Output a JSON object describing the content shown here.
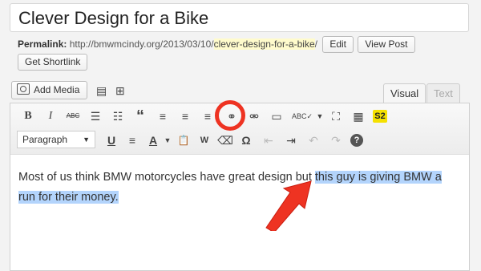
{
  "post": {
    "title": "Clever Design for a Bike"
  },
  "permalink": {
    "label": "Permalink:",
    "base": "http://bmwmcindy.org/2013/03/10/",
    "slug": "clever-design-for-a-bike",
    "trailing": "/",
    "edit_label": "Edit",
    "view_post_label": "View Post",
    "shortlink_label": "Get Shortlink"
  },
  "media": {
    "add_media_label": "Add Media"
  },
  "tabs": [
    {
      "label": "Visual",
      "active": true
    },
    {
      "label": "Text",
      "active": false
    }
  ],
  "toolbar": {
    "row1": [
      {
        "name": "bold-icon",
        "glyph": "B"
      },
      {
        "name": "italic-icon",
        "glyph": "I"
      },
      {
        "name": "strikethrough-icon",
        "glyph": "ABC"
      },
      {
        "name": "bullet-list-icon",
        "glyph": "☰"
      },
      {
        "name": "numbered-list-icon",
        "glyph": "☷"
      },
      {
        "name": "blockquote-icon",
        "glyph": "“"
      },
      {
        "name": "align-left-icon",
        "glyph": "≡"
      },
      {
        "name": "align-center-icon",
        "glyph": "≡"
      },
      {
        "name": "align-right-icon",
        "glyph": "≡"
      },
      {
        "name": "insert-link-icon",
        "glyph": "⚭"
      },
      {
        "name": "unlink-icon",
        "glyph": "⚮"
      },
      {
        "name": "insert-more-icon",
        "glyph": "▭"
      },
      {
        "name": "spellcheck-icon",
        "glyph": "ABC✓"
      },
      {
        "name": "fullscreen-icon",
        "glyph": "⛶"
      },
      {
        "name": "toolbar-toggle-icon",
        "glyph": "▦"
      },
      {
        "name": "s2-icon",
        "glyph": "S2"
      }
    ],
    "row2": [
      {
        "name": "underline-icon",
        "glyph": "U"
      },
      {
        "name": "justify-icon",
        "glyph": "≡"
      },
      {
        "name": "text-color-icon",
        "glyph": "A"
      },
      {
        "name": "paste-text-icon",
        "glyph": "📋"
      },
      {
        "name": "paste-word-icon",
        "glyph": "W"
      },
      {
        "name": "clear-formatting-icon",
        "glyph": "⌫"
      },
      {
        "name": "special-character-icon",
        "glyph": "Ω"
      },
      {
        "name": "outdent-icon",
        "glyph": "⇤"
      },
      {
        "name": "indent-icon",
        "glyph": "⇥"
      },
      {
        "name": "undo-icon",
        "glyph": "↶"
      },
      {
        "name": "redo-icon",
        "glyph": "↷"
      },
      {
        "name": "help-icon",
        "glyph": "?"
      }
    ],
    "format_select": "Paragraph"
  },
  "content": {
    "text_before": "Most of us think BMW motorcycles have great design but ",
    "text_selected": "this guy is giving BMW a run for their money."
  },
  "annotation": {
    "circle_color": "#ee3322",
    "arrow_color": "#ee3322"
  }
}
